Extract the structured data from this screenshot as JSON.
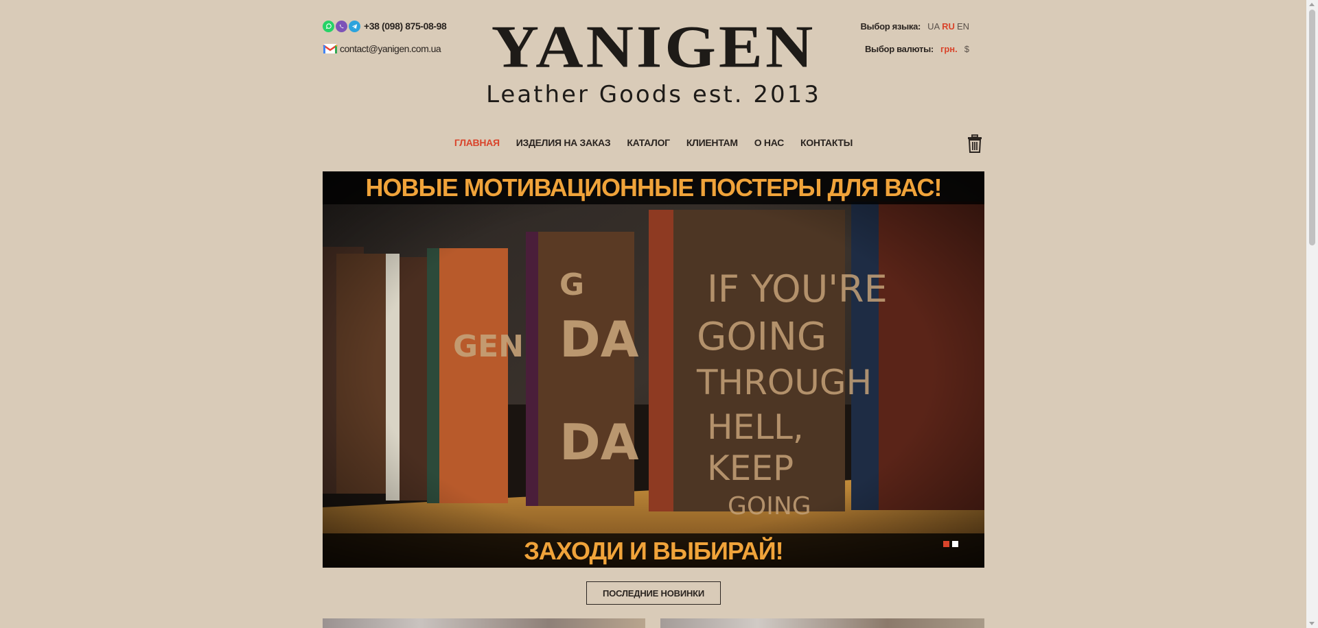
{
  "header": {
    "phone": "+38 (098) 875-08-98",
    "email": "contact@yanigen.com.ua",
    "messengers": [
      "whatsapp-icon",
      "viber-icon",
      "telegram-icon"
    ],
    "logo_title": "YANIGEN",
    "logo_subtitle": "Leather Goods est. 2013",
    "language_label": "Выбор языка:",
    "languages": [
      {
        "code": "UA",
        "active": false
      },
      {
        "code": "RU",
        "active": true
      },
      {
        "code": "EN",
        "active": false
      }
    ],
    "currency_label": "Выбор валюты:",
    "currencies": [
      {
        "label": "грн.",
        "active": true
      },
      {
        "label": "$",
        "active": false
      }
    ]
  },
  "nav": {
    "items": [
      {
        "label": "ГЛАВНАЯ",
        "active": true
      },
      {
        "label": "ИЗДЕЛИЯ НА ЗАКАЗ",
        "active": false
      },
      {
        "label": "КАТАЛОГ",
        "active": false
      },
      {
        "label": "КЛИЕНТАМ",
        "active": false
      },
      {
        "label": "О НАС",
        "active": false
      },
      {
        "label": "КОНТАКТЫ",
        "active": false
      }
    ],
    "cart_icon": "trash-cart-icon"
  },
  "slider": {
    "top_banner": "НОВЫЕ МОТИВАЦИОННЫЕ ПОСТЕРЫ ДЛЯ ВАС!",
    "bottom_banner": "ЗАХОДИ И ВЫБИРАЙ!",
    "dots_total": 2,
    "dots_active": 1
  },
  "buttons": {
    "latest": "ПОСЛЕДНИЕ НОВИНКИ"
  },
  "colors": {
    "background": "#d9cbb8",
    "accent": "#d9442b",
    "banner_text": "#f0a33a"
  }
}
